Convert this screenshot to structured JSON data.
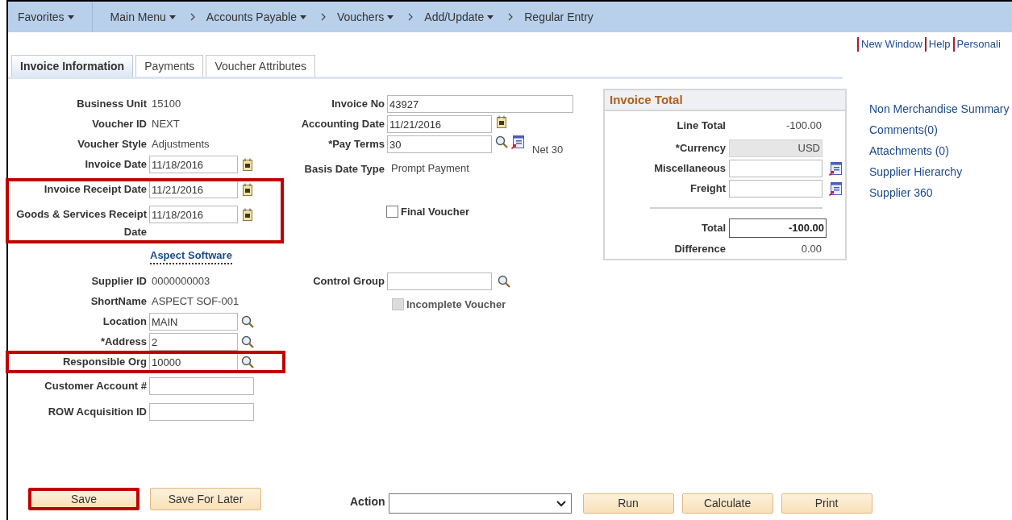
{
  "nav": [
    {
      "label": "Favorites",
      "chevron_before": false,
      "dropdown": true,
      "divider_after": true
    },
    {
      "label": "Main Menu",
      "chevron_before": false,
      "dropdown": true,
      "divider_after": false
    },
    {
      "label": "Accounts Payable",
      "chevron_before": true,
      "dropdown": true,
      "divider_after": false
    },
    {
      "label": "Vouchers",
      "chevron_before": true,
      "dropdown": true,
      "divider_after": false
    },
    {
      "label": "Add/Update",
      "chevron_before": true,
      "dropdown": true,
      "divider_after": false
    },
    {
      "label": "Regular Entry",
      "chevron_before": true,
      "dropdown": false,
      "divider_after": false
    }
  ],
  "top_links": [
    "New Window",
    "Help",
    "Personali"
  ],
  "tabs": [
    {
      "label": "Invoice Information",
      "selected": true
    },
    {
      "label": "Payments",
      "selected": false
    },
    {
      "label": "Voucher Attributes",
      "selected": false
    }
  ],
  "left_fields": [
    {
      "kind": "display",
      "label": "Business Unit",
      "value": "15100",
      "highlighted": false
    },
    {
      "kind": "display",
      "label": "Voucher ID",
      "value": "NEXT",
      "highlighted": false
    },
    {
      "kind": "display",
      "label": "Voucher Style",
      "value": "Adjustments",
      "highlighted": false
    },
    {
      "kind": "date",
      "label": "Invoice Date",
      "value": "11/18/2016",
      "highlighted": false
    },
    {
      "kind": "date",
      "label": "Invoice Receipt Date",
      "value": "11/21/2016",
      "highlighted": true
    },
    {
      "kind": "date",
      "label": "Goods & Services Receipt Date",
      "value": "11/18/2016",
      "highlighted": true
    },
    {
      "kind": "link",
      "value": "Aspect Software",
      "highlighted": false
    },
    {
      "kind": "display",
      "label": "Supplier ID",
      "value": "0000000003",
      "highlighted": false
    },
    {
      "kind": "display",
      "label": "ShortName",
      "value": "ASPECT SOF-001",
      "highlighted": false
    },
    {
      "kind": "lookup",
      "label": "Location",
      "value": "MAIN",
      "highlighted": false
    },
    {
      "kind": "lookup",
      "label": "*Address",
      "value": "2",
      "highlighted": false
    },
    {
      "kind": "lookup",
      "label": "Responsible Org",
      "value": "10000",
      "highlighted": true
    },
    {
      "kind": "text",
      "label": "Customer Account #",
      "highlighted": false
    },
    {
      "kind": "text",
      "label": "ROW Acquisition ID",
      "highlighted": false
    }
  ],
  "middle": {
    "fields": [
      {
        "kind": "text",
        "label": "Invoice No",
        "value": "43927"
      },
      {
        "kind": "date",
        "label": "Accounting Date",
        "value": "11/21/2016"
      },
      {
        "kind": "lookup_detail",
        "label": "*Pay Terms",
        "value": "30",
        "note": "Net 30"
      },
      {
        "kind": "display",
        "label": "Basis Date Type",
        "value": "Prompt Payment"
      }
    ],
    "final_voucher": {
      "label": "Final Voucher",
      "checked": false,
      "disabled": false
    },
    "control_group": {
      "label": "Control Group"
    },
    "incomplete_voucher": {
      "label": "Incomplete Voucher",
      "checked": false,
      "disabled": true
    }
  },
  "invoice_total": {
    "title": "Invoice Total",
    "rows": [
      {
        "kind": "display",
        "label": "Line Total",
        "value": "-100.00"
      },
      {
        "kind": "readonly",
        "label": "*Currency",
        "value": "USD"
      },
      {
        "kind": "input_detail",
        "label": "Miscellaneous"
      },
      {
        "kind": "input_detail",
        "label": "Freight"
      },
      {
        "kind": "total",
        "label": "Total",
        "value": "-100.00"
      },
      {
        "kind": "display",
        "label": "Difference",
        "value": "0.00"
      }
    ]
  },
  "side_links": [
    "Non Merchandise Summary",
    "Comments(0)",
    "Attachments (0)",
    "Supplier Hierarchy",
    "Supplier 360"
  ],
  "bottom_buttons": [
    {
      "label": "Save",
      "highlighted": true
    },
    {
      "label": "Save For Later",
      "highlighted": false
    }
  ],
  "action": {
    "label": "Action"
  },
  "action_buttons": [
    "Run",
    "Calculate",
    "Print"
  ]
}
